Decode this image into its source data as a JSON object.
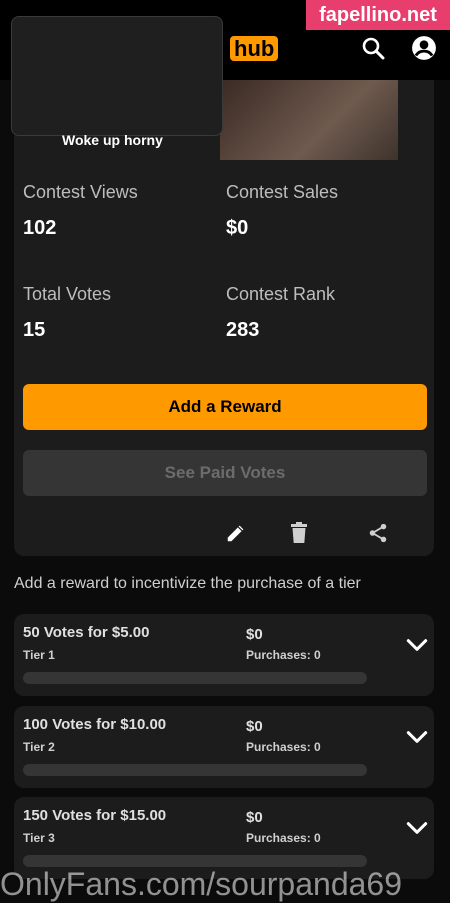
{
  "header": {
    "logo_prefix": "",
    "logo_hub": "hub",
    "search_icon": "search-icon",
    "account_icon": "account-icon"
  },
  "watermarks": {
    "top": "fapellino.net",
    "bottom": "OnlyFans.com/sourpanda69"
  },
  "contest_card": {
    "video_title": "Woke up horny",
    "stats": {
      "views_label": "Contest Views",
      "views_value": "102",
      "sales_label": "Contest Sales",
      "sales_value": "$0",
      "votes_label": "Total Votes",
      "votes_value": "15",
      "rank_label": "Contest Rank",
      "rank_value": "283"
    },
    "add_reward_label": "Add a Reward",
    "see_paid_votes_label": "See Paid Votes",
    "action_icons": [
      "edit-icon",
      "delete-icon",
      "share-icon"
    ]
  },
  "rewards": {
    "hint": "Add a reward to incentivize the purchase of a tier",
    "tiers": [
      {
        "title": "50 Votes for $5.00",
        "tier": "Tier 1",
        "amount": "$0",
        "purchases": "Purchases: 0",
        "progress": 0
      },
      {
        "title": "100 Votes for $10.00",
        "tier": "Tier 2",
        "amount": "$0",
        "purchases": "Purchases: 0",
        "progress": 0
      },
      {
        "title": "150 Votes for $15.00",
        "tier": "Tier 3",
        "amount": "$0",
        "purchases": "Purchases: 0",
        "progress": 0
      }
    ]
  },
  "colors": {
    "accent": "#ff9900",
    "background": "#0b0b0b",
    "card": "#1c1c1c"
  }
}
